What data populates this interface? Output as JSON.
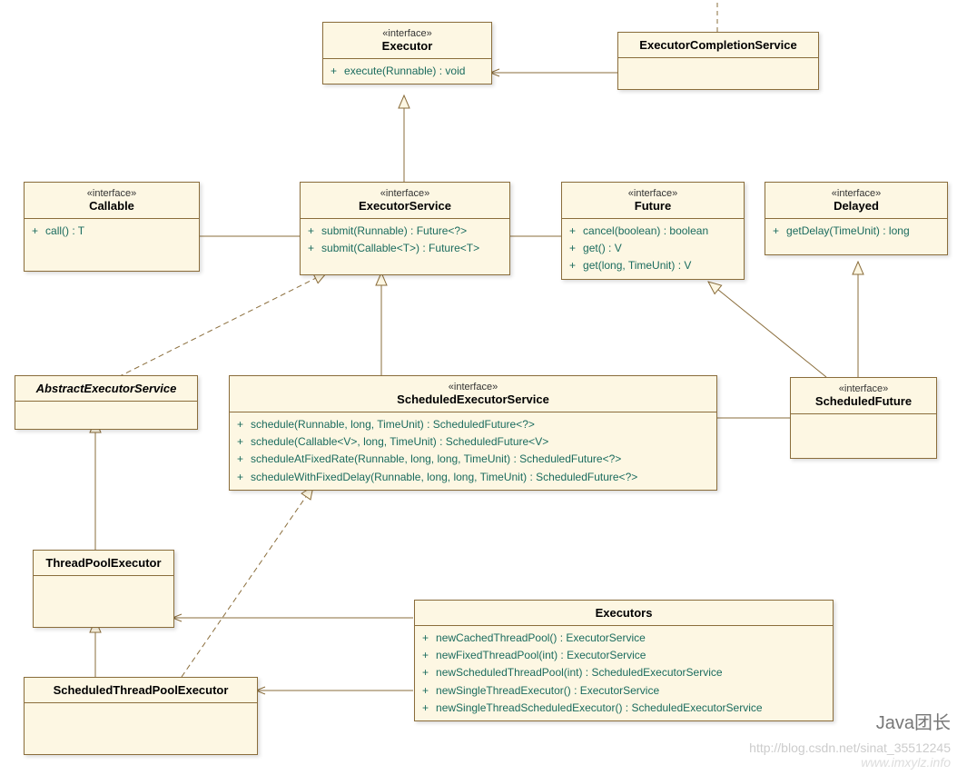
{
  "chart_data": {
    "type": "uml-class-diagram",
    "classes": [
      {
        "id": "Executor",
        "stereotype": "«interface»",
        "name": "Executor",
        "methods": [
          "execute(Runnable) : void"
        ]
      },
      {
        "id": "ExecutorCompletionService",
        "name": "ExecutorCompletionService",
        "methods": []
      },
      {
        "id": "Callable",
        "stereotype": "«interface»",
        "name": "Callable",
        "methods": [
          "call() : T"
        ]
      },
      {
        "id": "ExecutorService",
        "stereotype": "«interface»",
        "name": "ExecutorService",
        "methods": [
          "submit(Runnable) : Future<?>",
          "submit(Callable<T>) : Future<T>"
        ]
      },
      {
        "id": "Future",
        "stereotype": "«interface»",
        "name": "Future",
        "methods": [
          "cancel(boolean) : boolean",
          "get() : V",
          "get(long, TimeUnit) : V"
        ]
      },
      {
        "id": "Delayed",
        "stereotype": "«interface»",
        "name": "Delayed",
        "methods": [
          "getDelay(TimeUnit) : long"
        ]
      },
      {
        "id": "AbstractExecutorService",
        "name": "AbstractExecutorService",
        "abstract": true,
        "methods": []
      },
      {
        "id": "ScheduledExecutorService",
        "stereotype": "«interface»",
        "name": "ScheduledExecutorService",
        "methods": [
          "schedule(Runnable, long, TimeUnit) : ScheduledFuture<?>",
          "schedule(Callable<V>, long, TimeUnit) : ScheduledFuture<V>",
          "scheduleAtFixedRate(Runnable, long, long, TimeUnit) : ScheduledFuture<?>",
          "scheduleWithFixedDelay(Runnable, long, long, TimeUnit) : ScheduledFuture<?>"
        ]
      },
      {
        "id": "ScheduledFuture",
        "stereotype": "«interface»",
        "name": "ScheduledFuture",
        "methods": []
      },
      {
        "id": "ThreadPoolExecutor",
        "name": "ThreadPoolExecutor",
        "methods": []
      },
      {
        "id": "ScheduledThreadPoolExecutor",
        "name": "ScheduledThreadPoolExecutor",
        "methods": []
      },
      {
        "id": "Executors",
        "name": "Executors",
        "methods": [
          "newCachedThreadPool() : ExecutorService",
          "newFixedThreadPool(int) : ExecutorService",
          "newScheduledThreadPool(int) : ScheduledExecutorService",
          "newSingleThreadExecutor() : ExecutorService",
          "newSingleThreadScheduledExecutor() : ScheduledExecutorService"
        ]
      }
    ],
    "relationships": [
      {
        "from": "ExecutorService",
        "to": "Executor",
        "type": "generalization"
      },
      {
        "from": "ExecutorCompletionService",
        "to": "Executor",
        "type": "association"
      },
      {
        "from": "Callable",
        "to": "ExecutorService",
        "type": "association"
      },
      {
        "from": "ExecutorService",
        "to": "Future",
        "type": "association"
      },
      {
        "from": "AbstractExecutorService",
        "to": "ExecutorService",
        "type": "realization"
      },
      {
        "from": "ScheduledExecutorService",
        "to": "ExecutorService",
        "type": "generalization"
      },
      {
        "from": "ScheduledFuture",
        "to": "Future",
        "type": "generalization"
      },
      {
        "from": "ScheduledFuture",
        "to": "Delayed",
        "type": "generalization"
      },
      {
        "from": "ScheduledExecutorService",
        "to": "ScheduledFuture",
        "type": "association"
      },
      {
        "from": "ThreadPoolExecutor",
        "to": "AbstractExecutorService",
        "type": "generalization"
      },
      {
        "from": "ScheduledThreadPoolExecutor",
        "to": "ThreadPoolExecutor",
        "type": "generalization"
      },
      {
        "from": "ScheduledThreadPoolExecutor",
        "to": "ScheduledExecutorService",
        "type": "realization"
      },
      {
        "from": "Executors",
        "to": "ThreadPoolExecutor",
        "type": "association"
      },
      {
        "from": "Executors",
        "to": "ScheduledThreadPoolExecutor",
        "type": "association"
      }
    ]
  },
  "wm1": "Java团长",
  "wm2": "http://blog.csdn.net/sinat_35512245",
  "wm3": "www.imxylz.info"
}
